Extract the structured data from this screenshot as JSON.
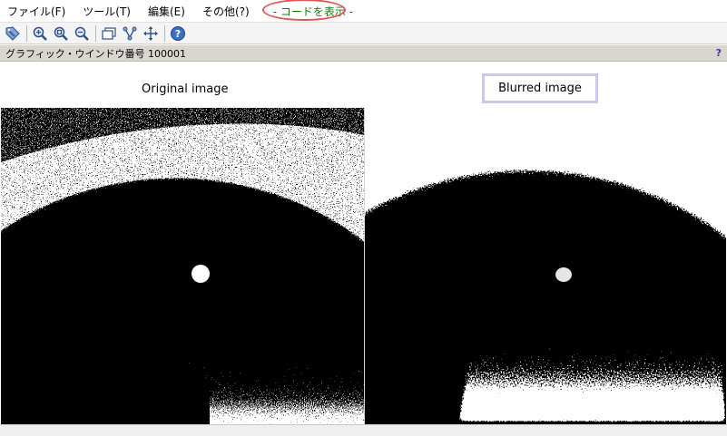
{
  "menu": {
    "items": [
      "ファイル(F)",
      "ツール(T)",
      "編集(E)",
      "その他(?)"
    ],
    "show_code": "- コードを表示 -"
  },
  "toolbar": {
    "tools": [
      "pointer-icon",
      "zoom-in-icon",
      "zoom-reset-icon",
      "zoom-out-icon",
      "window-icon",
      "graph-icon",
      "move-icon",
      "help-icon"
    ]
  },
  "title_strip": {
    "title": "グラフィック・ウインドウ番号 100001",
    "help": "?"
  },
  "figure": {
    "original_label": "Original image",
    "blurred_label": "Blurred  image"
  },
  "colors": {
    "accent_oval": "#e0555a",
    "show_code_text": "#1a7a1a",
    "highlight_box": "#c9c6f0",
    "title_strip_bg": "#d9d6d0"
  }
}
